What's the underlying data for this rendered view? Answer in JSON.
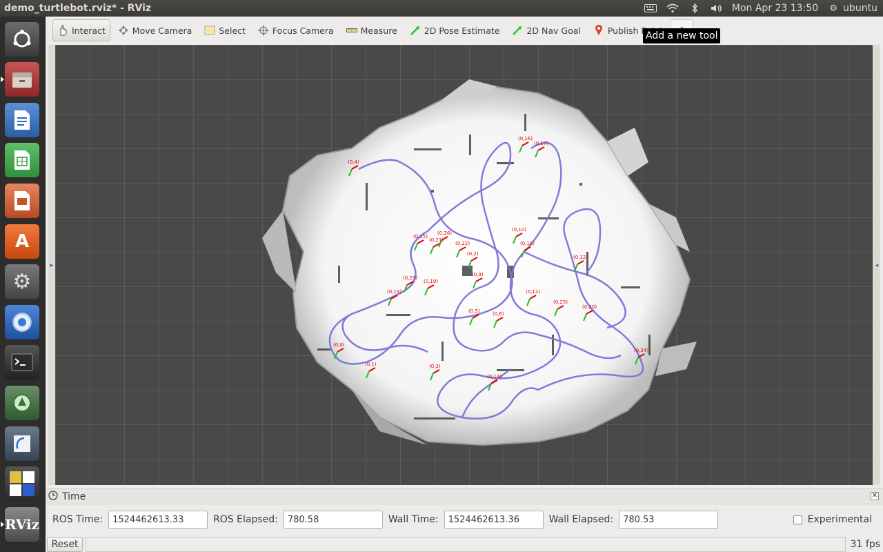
{
  "window": {
    "title": "demo_turtlebot.rviz* - RViz"
  },
  "system_tray": {
    "clock": "Mon Apr 23 13:50",
    "user": "ubuntu",
    "icons": [
      "keyboard-icon",
      "wifi-icon",
      "bluetooth-icon",
      "volume-icon",
      "settings-gear-icon"
    ]
  },
  "launcher": {
    "items": [
      {
        "name": "ubuntu-dash-icon",
        "color": "#3a3a3a"
      },
      {
        "name": "files-icon",
        "color": "#9b2c2c"
      },
      {
        "name": "libreoffice-writer-icon",
        "color": "#2a6bb5"
      },
      {
        "name": "libreoffice-calc-icon",
        "color": "#2f8f3a"
      },
      {
        "name": "libreoffice-impress-icon",
        "color": "#c8522b"
      },
      {
        "name": "software-center-icon",
        "color": "#e05a1f"
      },
      {
        "name": "system-settings-icon",
        "color": "#555555"
      },
      {
        "name": "chromium-icon",
        "color": "#2c63b6"
      },
      {
        "name": "terminal-icon",
        "color": "#2b2b2b"
      },
      {
        "name": "rqt-icon",
        "color": "#3b7a3b"
      },
      {
        "name": "qtcreator-icon",
        "color": "#445566"
      },
      {
        "name": "workspace-switcher-icon",
        "color": "#3a3a3a"
      },
      {
        "name": "rviz-icon",
        "color": "#555555"
      }
    ]
  },
  "toolbar": {
    "tools": [
      {
        "id": "interact",
        "label": "Interact",
        "icon": "hand-icon",
        "active": true
      },
      {
        "id": "move-camera",
        "label": "Move Camera",
        "icon": "move-camera-icon",
        "active": false
      },
      {
        "id": "select",
        "label": "Select",
        "icon": "select-box-icon",
        "active": false
      },
      {
        "id": "focus-camera",
        "label": "Focus Camera",
        "icon": "crosshair-icon",
        "active": false
      },
      {
        "id": "measure",
        "label": "Measure",
        "icon": "ruler-icon",
        "active": false
      },
      {
        "id": "2d-pose",
        "label": "2D Pose Estimate",
        "icon": "green-arrow-icon",
        "active": false
      },
      {
        "id": "2d-nav",
        "label": "2D Nav Goal",
        "icon": "green-arrow-icon",
        "active": false
      },
      {
        "id": "publish-point",
        "label": "Publish Point",
        "icon": "map-pin-icon",
        "active": false
      }
    ],
    "add_tool_tooltip": "Add a new tool"
  },
  "map_labels": [
    "(0,4)",
    "(0,17)",
    "(0,16)",
    "(0,15)",
    "(0,26)",
    "(0,10)",
    "(0,18)",
    "(0,21)",
    "(0,22)",
    "(0,2)",
    "(0,23)",
    "(0,19)",
    "(0,13)",
    "(0,9)",
    "(0,6)",
    "(0,5)",
    "(0,24)",
    "(0,14)",
    "(0,3)",
    "(0,1)",
    "(0,0)",
    "(0,11)",
    "(0,12)",
    "(0,25)",
    "(0,20)"
  ],
  "time_panel": {
    "title": "Time",
    "ros_time_label": "ROS Time:",
    "ros_time": "1524462613.33",
    "ros_elapsed_label": "ROS Elapsed:",
    "ros_elapsed": "780.58",
    "wall_time_label": "Wall Time:",
    "wall_time": "1524462613.36",
    "wall_elapsed_label": "Wall Elapsed:",
    "wall_elapsed": "780.53",
    "experimental_label": "Experimental"
  },
  "status_bar": {
    "reset_label": "Reset",
    "fps": "31 fps"
  }
}
